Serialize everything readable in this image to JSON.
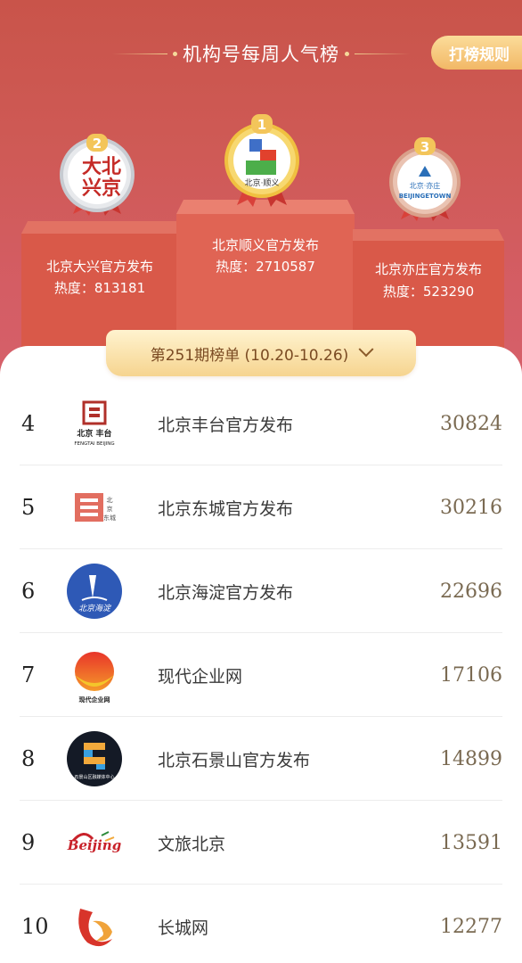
{
  "header": {
    "title": "机构号每周人气榜",
    "rules_label": "打榜规则"
  },
  "podium": [
    {
      "rank": "2",
      "name": "北京大兴官方发布",
      "heat": "热度：813181",
      "logo_text": "大兴北京"
    },
    {
      "rank": "1",
      "name": "北京顺义官方发布",
      "heat": "热度：2710587"
    },
    {
      "rank": "3",
      "name": "北京亦庄官方发布",
      "heat": "热度：523290",
      "logo_text": "北京·亦庄 BEIJINGETOWN"
    }
  ],
  "period": {
    "label": "第251期榜单 (10.20-10.26)"
  },
  "list": [
    {
      "rank": "4",
      "name": "北京丰台官方发布",
      "score": "30824",
      "logo_text": "北京丰台 FENGTAI BEIJING"
    },
    {
      "rank": "5",
      "name": "北京东城官方发布",
      "score": "30216",
      "logo_text": "北京·东城"
    },
    {
      "rank": "6",
      "name": "北京海淀官方发布",
      "score": "22696",
      "logo_text": "北京海淀"
    },
    {
      "rank": "7",
      "name": "现代企业网",
      "score": "17106",
      "logo_text": "现代企业网"
    },
    {
      "rank": "8",
      "name": "北京石景山官方发布",
      "score": "14899",
      "logo_text": "石景山区融媒体中心"
    },
    {
      "rank": "9",
      "name": "文旅北京",
      "score": "13591",
      "logo_text": "Beijing"
    },
    {
      "rank": "10",
      "name": "长城网",
      "score": "12277"
    }
  ],
  "colors": {
    "hero_bg": "#cf5a56",
    "gold": "#f2b866",
    "score_text": "#7a6a52"
  }
}
